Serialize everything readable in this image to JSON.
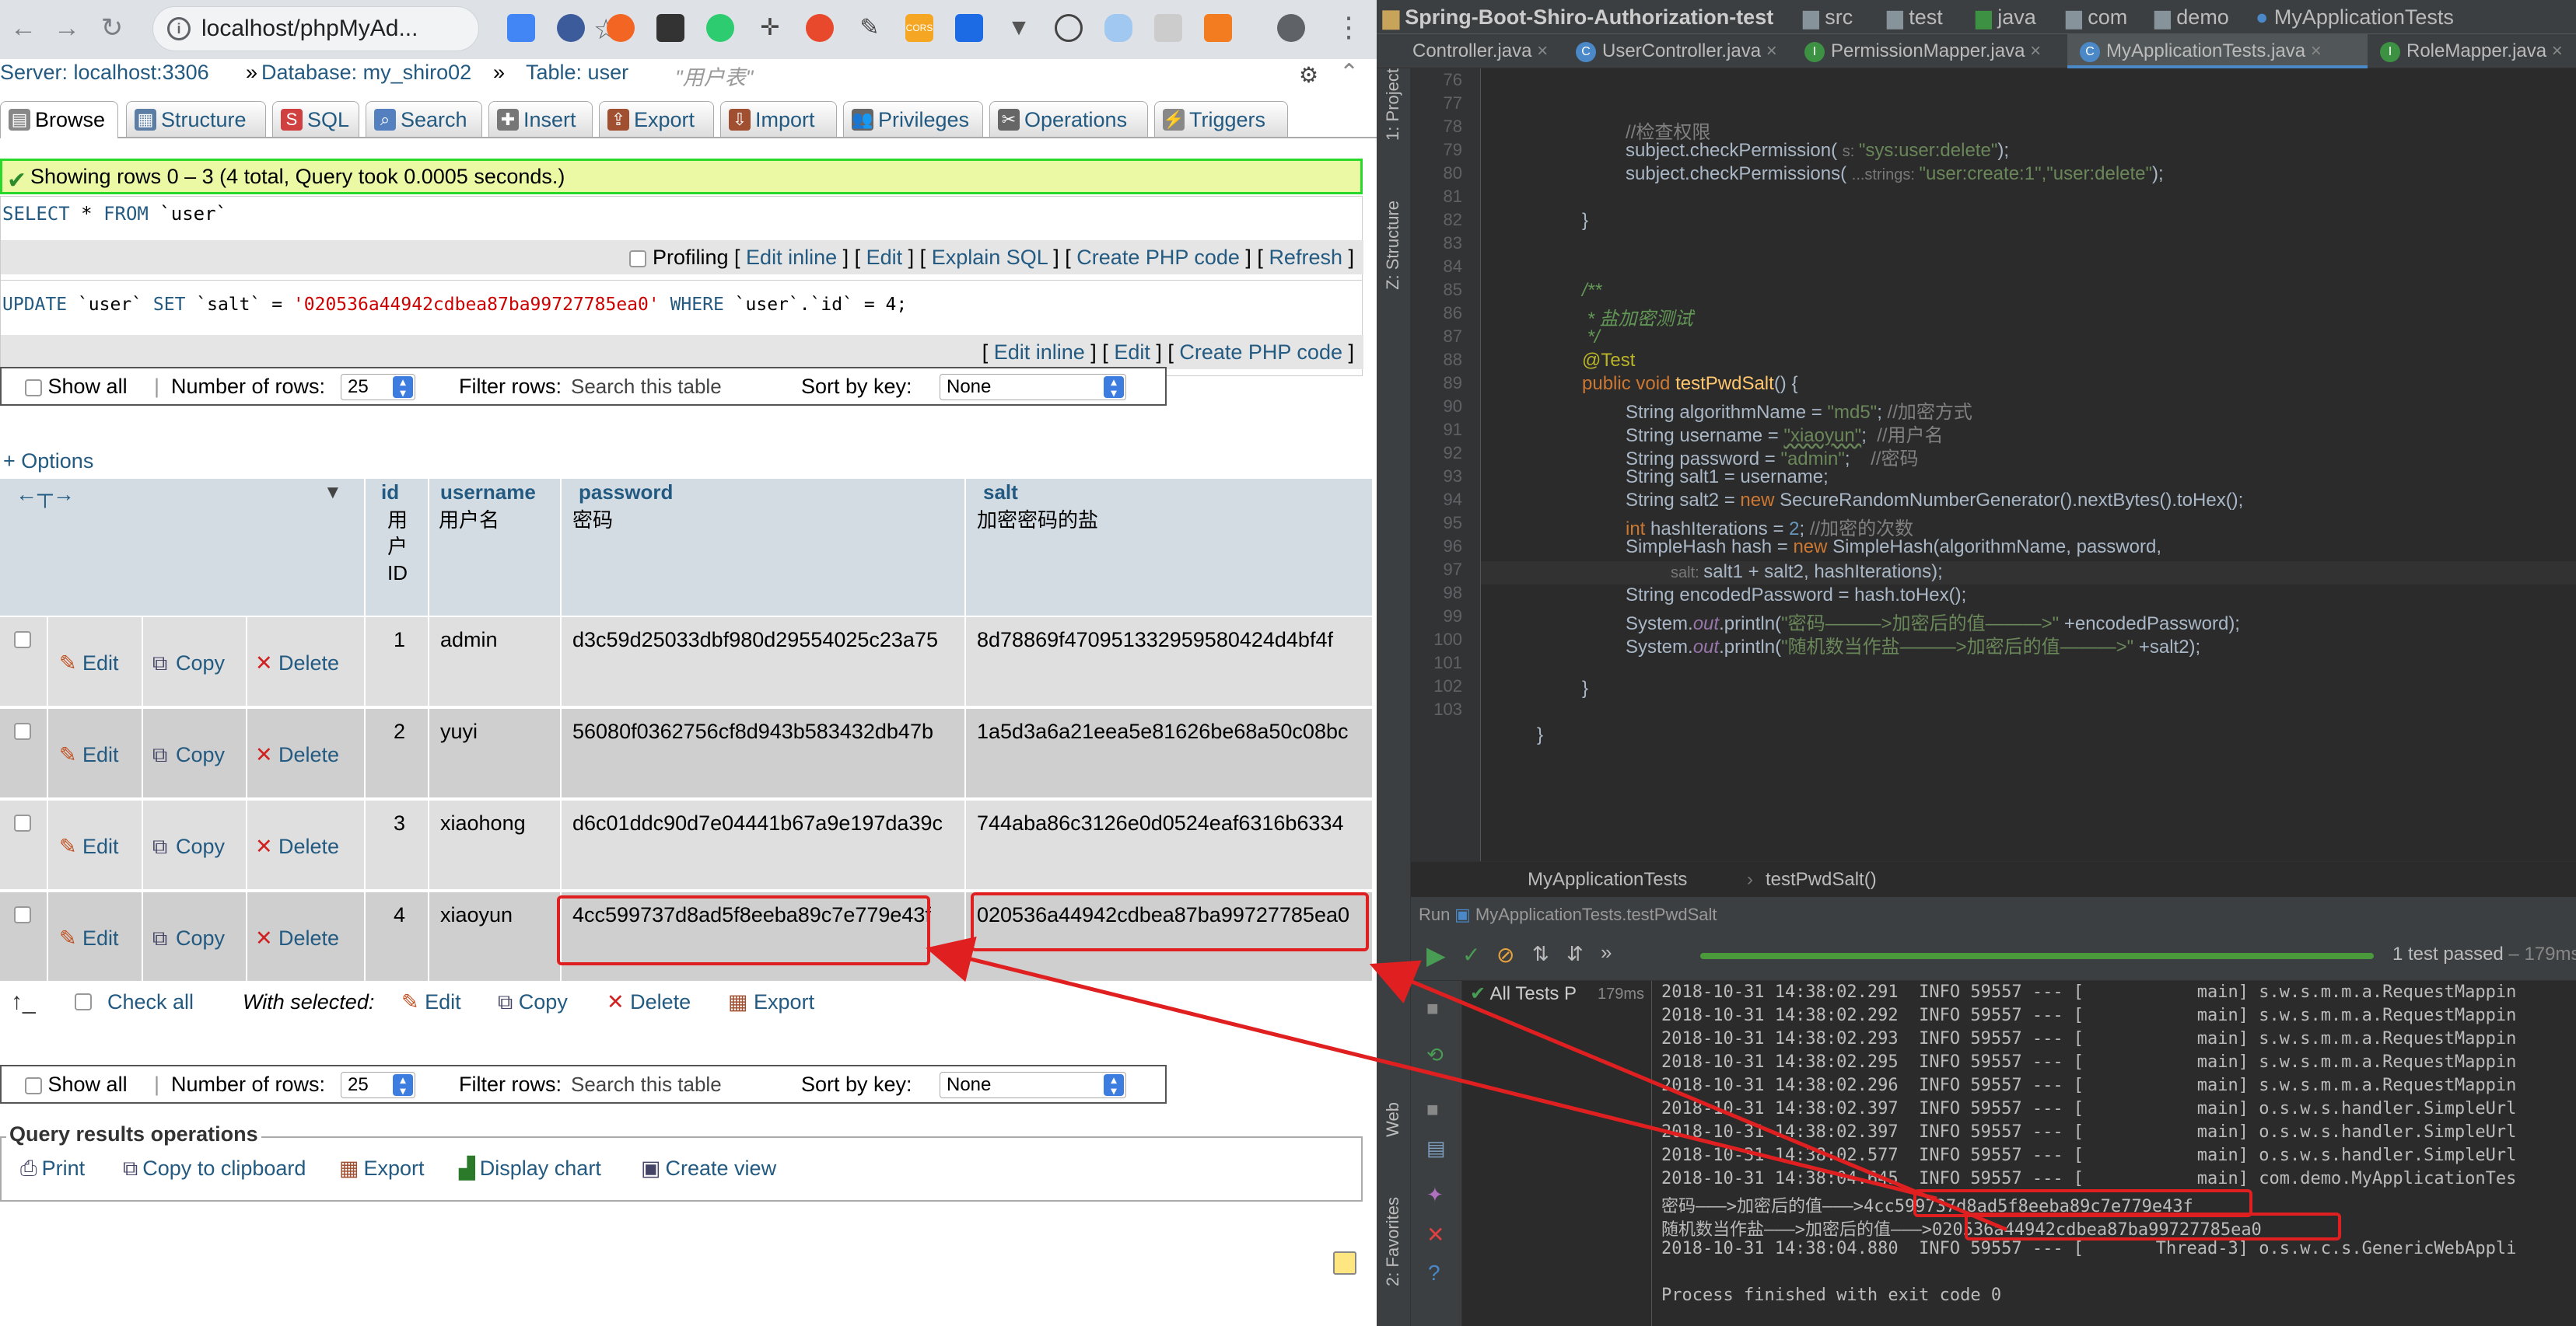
{
  "browser": {
    "url": "localhost/phpMyAd...",
    "breadcrumb": {
      "server": "Server: localhost:3306",
      "database": "Database: my_shiro02",
      "table": "Table: user",
      "comment": "\"用户表\""
    },
    "tabs": [
      "Browse",
      "Structure",
      "SQL",
      "Search",
      "Insert",
      "Export",
      "Import",
      "Privileges",
      "Operations",
      "Triggers"
    ],
    "success_msg": "Showing rows 0 – 3 (4 total, Query took 0.0005 seconds.)",
    "query1": {
      "kw1": "SELECT",
      "mid": " * ",
      "kw2": "FROM",
      "table": " `user`"
    },
    "query1_toolbar": {
      "profiling": "Profiling",
      "links": [
        "Edit inline",
        "Edit",
        "Explain SQL",
        "Create PHP code",
        "Refresh"
      ]
    },
    "query2": {
      "kw1": "UPDATE",
      "t1": " `user` ",
      "kw2": "SET",
      "col": " `salt` = ",
      "val": "'020536a44942cdbea87ba99727785ea0'",
      "kw3": " WHERE ",
      "cond": "`user`.`id` = 4;"
    },
    "query2_toolbar": {
      "links": [
        "Edit inline",
        "Edit",
        "Create PHP code"
      ]
    },
    "nav": {
      "show_all": "Show all",
      "rows_label": "Number of rows:",
      "rows_value": "25",
      "filter_label": "Filter rows:",
      "filter_placeholder": "Search this table",
      "sort_label": "Sort by key:",
      "sort_value": "None"
    },
    "options_link": "+ Options",
    "columns": [
      {
        "name": "id",
        "comment": "用户ID"
      },
      {
        "name": "username",
        "comment": "用户名"
      },
      {
        "name": "password",
        "comment": "密码"
      },
      {
        "name": "salt",
        "comment": "加密密码的盐"
      }
    ],
    "row_actions": {
      "edit": "Edit",
      "copy": "Copy",
      "delete": "Delete"
    },
    "rows": [
      {
        "id": "1",
        "username": "admin",
        "password": "d3c59d25033dbf980d29554025c23a75",
        "salt": "8d78869f470951332959580424d4bf4f"
      },
      {
        "id": "2",
        "username": "yuyi",
        "password": "56080f0362756cf8d943b583432db47b",
        "salt": "1a5d3a6a21eea5e81626be68a50c08bc"
      },
      {
        "id": "3",
        "username": "xiaohong",
        "password": "d6c01ddc90d7e04441b67a9e197da39c",
        "salt": "744aba86c3126e0d0524eaf6316b6334"
      },
      {
        "id": "4",
        "username": "xiaoyun",
        "password": "4cc599737d8ad5f8eeba89c7e779e43f",
        "salt": "020536a44942cdbea87ba99727785ea0"
      }
    ],
    "with_selected": {
      "check_all": "Check all",
      "label": "With selected:",
      "edit": "Edit",
      "copy": "Copy",
      "delete": "Delete",
      "export": "Export"
    },
    "qro": {
      "title": "Query results operations",
      "links": [
        "Print",
        "Copy to clipboard",
        "Export",
        "Display chart",
        "Create view"
      ]
    }
  },
  "ide": {
    "project": "Spring-Boot-Shiro-Authorization-test",
    "path": [
      "src",
      "test",
      "java",
      "com",
      "demo",
      "MyApplicationTests"
    ],
    "tabs": [
      "Controller.java",
      "UserController.java",
      "PermissionMapper.java",
      "MyApplicationTests.java",
      "RoleMapper.java"
    ],
    "side_labels": [
      "1: Project",
      "Z: Structure",
      "Web",
      "2: Favorites"
    ],
    "line_numbers": [
      "76",
      "77",
      "78",
      "79",
      "80",
      "81",
      "82",
      "83",
      "84",
      "85",
      "86",
      "87",
      "88",
      "89",
      "90",
      "91",
      "92",
      "93",
      "94",
      "95",
      "96",
      "97",
      "98",
      "99",
      "100",
      "101",
      "102",
      "103"
    ],
    "code": {
      "l77": "//检查权限",
      "l78a": "subject.checkPermission( ",
      "l78h": "s: ",
      "l78s": "\"sys:user:delete\"",
      "l78b": ");",
      "l79a": "subject.checkPermissions( ",
      "l79h": "...strings: ",
      "l79s": "\"user:create:1\",\"user:delete\"",
      "l79b": ");",
      "l81": "}",
      "l84": "/**",
      "l85": " * 盐加密测试",
      "l86": " */",
      "l87": "@Test",
      "l88k": "public void ",
      "l88f": "testPwdSalt",
      "l88b": "() {",
      "l89a": "String algorithmName = ",
      "l89s": "\"md5\"",
      "l89b": "; ",
      "l89c": "//加密方式",
      "l90a": "String username = ",
      "l90s": "\"xiaoyun\"",
      "l90b": ";  ",
      "l90c": "//用户名",
      "l91a": "String password = ",
      "l91s": "\"admin\"",
      "l91b": ";    ",
      "l91c": "//密码",
      "l92": "String salt1 = username;",
      "l93a": "String salt2 = ",
      "l93k": "new ",
      "l93b": "SecureRandomNumberGenerator().nextBytes().toHex();",
      "l94k": "int ",
      "l94a": "hashIterations = ",
      "l94n": "2",
      "l94b": "; ",
      "l94c": "//加密的次数",
      "l95a": "SimpleHash hash = ",
      "l95k": "new ",
      "l95b": "SimpleHash(algorithmName, password,",
      "l96h": "salt: ",
      "l96b": "salt1 + salt2, hashIterations);",
      "l97": "String encodedPassword = hash.toHex();",
      "l98a": "System.",
      "l98o": "out",
      "l98b": ".println(",
      "l98s": "\"密码———>加密后的值———>\"",
      "l98c": " +encodedPassword);",
      "l99a": "System.",
      "l99o": "out",
      "l99b": ".println(",
      "l99s": "\"随机数当作盐———>加密后的值———>\"",
      "l99c": " +salt2);",
      "l101": "}",
      "l103": "}"
    },
    "breadcrumb": [
      "MyApplicationTests",
      "testPwdSalt()"
    ],
    "run_label": "Run",
    "run_config": "MyApplicationTests.testPwdSalt",
    "test_status": "1 test passed",
    "test_time": " – 179ms",
    "tree": {
      "label": "All Tests P",
      "time": "179ms"
    },
    "console": [
      "2018-10-31 14:38:02.291  INFO 59557 --- [           main] s.w.s.m.m.a.RequestMappin",
      "2018-10-31 14:38:02.292  INFO 59557 --- [           main] s.w.s.m.m.a.RequestMappin",
      "2018-10-31 14:38:02.293  INFO 59557 --- [           main] s.w.s.m.m.a.RequestMappin",
      "2018-10-31 14:38:02.295  INFO 59557 --- [           main] s.w.s.m.m.a.RequestMappin",
      "2018-10-31 14:38:02.296  INFO 59557 --- [           main] s.w.s.m.m.a.RequestMappin",
      "2018-10-31 14:38:02.397  INFO 59557 --- [           main] o.s.w.s.handler.SimpleUrl",
      "2018-10-31 14:38:02.397  INFO 59557 --- [           main] o.s.w.s.handler.SimpleUrl",
      "2018-10-31 14:38:02.577  INFO 59557 --- [           main] o.s.w.s.handler.SimpleUrl",
      "2018-10-31 14:38:04.645  INFO 59557 --- [           main] com.demo.MyApplicationTes",
      "密码———>加密后的值———>4cc599737d8ad5f8eeba89c7e779e43f",
      "随机数当作盐———>加密后的值———>020536a44942cdbea87ba99727785ea0",
      "2018-10-31 14:38:04.880  INFO 59557 --- [       Thread-3] o.s.w.c.s.GenericWebAppli",
      "",
      "Process finished with exit code 0"
    ]
  },
  "colors": {
    "pma_link": "#235a81",
    "success_bg": "#ebf8a4",
    "ide_bg": "#2b2b2b",
    "highlight": "#e02020"
  }
}
